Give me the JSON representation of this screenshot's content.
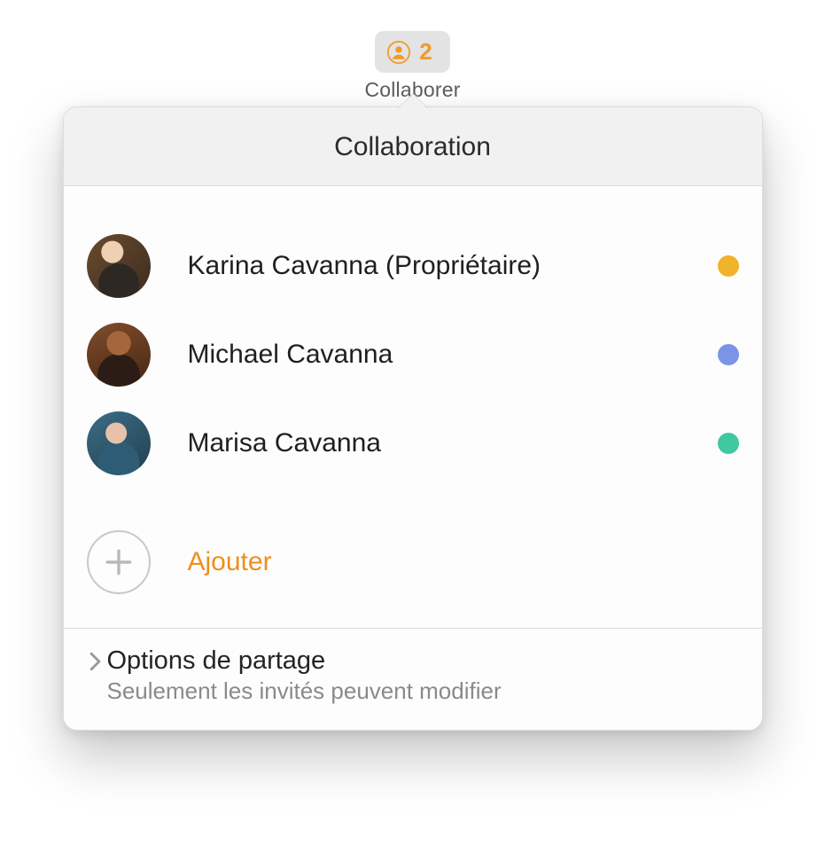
{
  "toolbar": {
    "collaborator_count": "2",
    "button_label": "Collaborer"
  },
  "popover": {
    "title": "Collaboration",
    "members": [
      {
        "name": "Karina Cavanna (Propriétaire)",
        "dot_color": "yellow"
      },
      {
        "name": "Michael Cavanna",
        "dot_color": "blue"
      },
      {
        "name": "Marisa Cavanna",
        "dot_color": "green"
      }
    ],
    "add_label": "Ajouter",
    "share": {
      "title": "Options de partage",
      "subtitle": "Seulement les invités peuvent modifier"
    }
  },
  "colors": {
    "accent_orange": "#ef8f19",
    "dot_yellow": "#f1b32a",
    "dot_blue": "#7c94e8",
    "dot_green": "#3ec9a0"
  }
}
